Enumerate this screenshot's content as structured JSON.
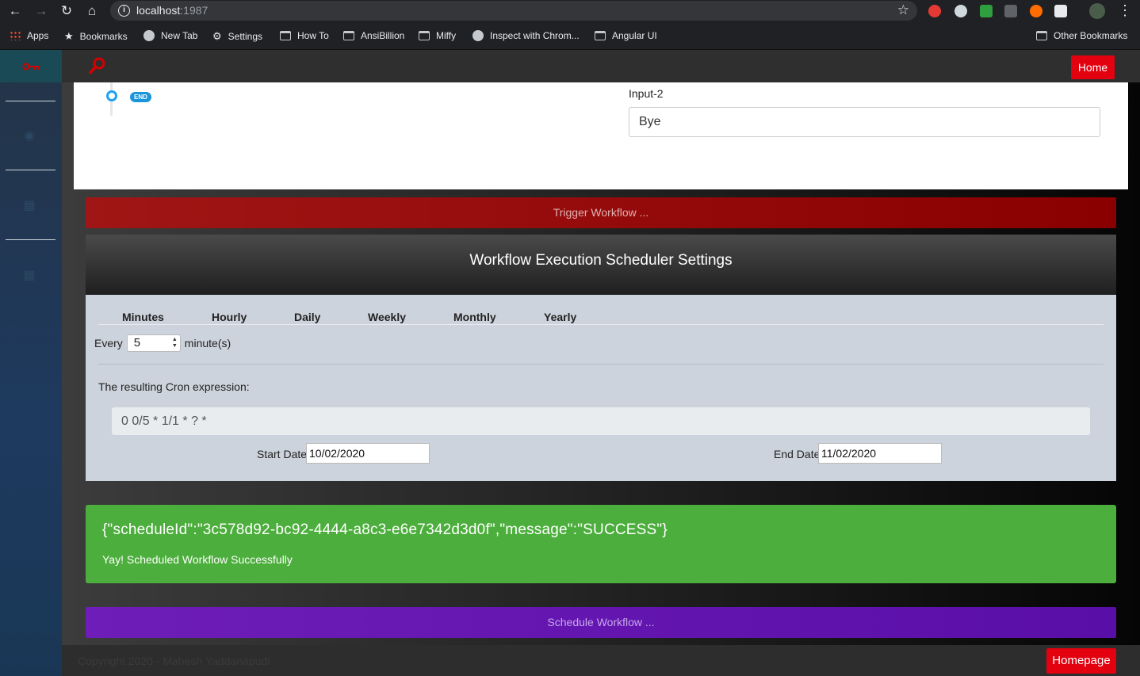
{
  "browser": {
    "url_host": "localhost",
    "url_port": ":1987",
    "bookmarks": [
      "Apps",
      "Bookmarks",
      "New Tab",
      "Settings",
      "How To",
      "AnsiBillion",
      "Miffy",
      "Inspect with Chrom...",
      "Angular UI"
    ],
    "other_bookmarks": "Other Bookmarks"
  },
  "topbar": {
    "home_label": "Home"
  },
  "workflow_preview": {
    "end_badge": "END",
    "input_label": "Input-2",
    "input_value": "Bye"
  },
  "trigger_label": "Trigger Workflow ...",
  "scheduler": {
    "title": "Workflow Execution Scheduler Settings",
    "tabs": [
      "Minutes",
      "Hourly",
      "Daily",
      "Weekly",
      "Monthly",
      "Yearly"
    ],
    "every_label": "Every",
    "every_value": "5",
    "unit_label": "minute(s)",
    "cron_label": "The resulting Cron expression:",
    "cron_value": "0 0/5 * 1/1 * ? *",
    "start_label": "Start Date",
    "start_value": "10/02/2020",
    "end_label": "End Date",
    "end_value": "11/02/2020"
  },
  "result": {
    "json": "{\"scheduleId\":\"3c578d92-bc92-4444-a8c3-e6e7342d3d0f\",\"message\":\"SUCCESS\"}",
    "message": "Yay! Scheduled Workflow Successfully"
  },
  "schedule_label": "Schedule Workflow ...",
  "footer": {
    "copyright": "Copyright 2020 - Mahesh Yaddanapudi",
    "homepage_label": "Homepage"
  }
}
